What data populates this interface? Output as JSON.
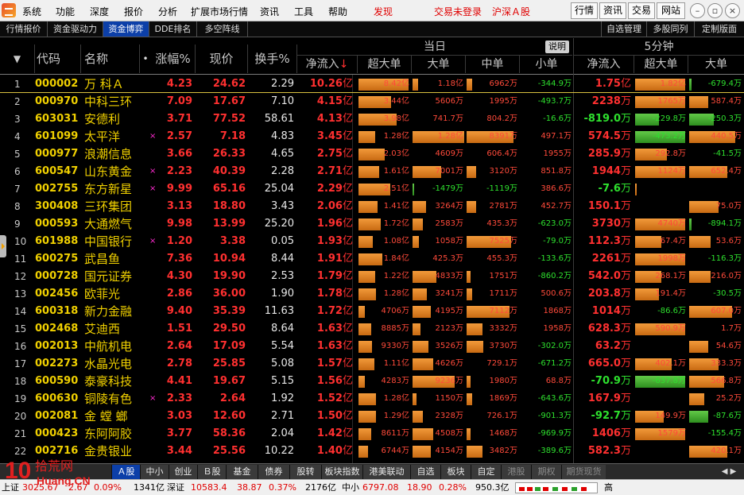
{
  "menubar": {
    "items": [
      "系统",
      "功能",
      "深度",
      "报价",
      "分析",
      "扩展市场行情",
      "资讯",
      "工具",
      "帮助"
    ],
    "discover": "发现",
    "trade_status": "交易未登录",
    "market_label": "沪深Ａ股",
    "buttons": [
      "行情",
      "资讯",
      "交易",
      "网站"
    ],
    "window_controls": [
      "minimize-icon",
      "restore-icon",
      "close-icon"
    ]
  },
  "tabs": {
    "left": [
      "行情报价",
      "资金驱动力",
      "资金博弈",
      "DDE排名",
      "多空阵线"
    ],
    "active": "资金博弈",
    "right": [
      "自选管理",
      "多股同列",
      "定制版面"
    ]
  },
  "header": {
    "sort_arrow": "▼",
    "code": "代码",
    "name": "名称",
    "name_dot": "•",
    "pct": "涨幅%",
    "price": "现价",
    "turnover": "换手%",
    "group_today": "当日",
    "explain": "说明",
    "group_5min": "5分钟",
    "net_inflow": "净流入",
    "net_sort_arrow": "↓",
    "super_large": "超大单",
    "large": "大单",
    "medium": "中单",
    "small": "小单",
    "net_inflow_5": "净流入",
    "super_large_5": "超大单",
    "large_5": "大单"
  },
  "bar_levels": "each bar fill is a fraction 0–1 of the cell width",
  "rows": [
    {
      "i": "1",
      "code": "000002",
      "name": "万 科Ａ",
      "mark": "",
      "pct": "4.23",
      "px": "24.62",
      "to": "2.29",
      "net": "10.26",
      "nu": "亿",
      "sl": {
        "t": "8.42亿",
        "f": 0.95
      },
      "lg": {
        "t": "1.18亿",
        "f": 0.1
      },
      "md": {
        "t": "6962万",
        "f": 0.1
      },
      "sm": {
        "t": "-344.9万",
        "f": 0.0,
        "neg": true
      },
      "net5": "1.75",
      "nu5": "亿",
      "sl5": {
        "t": "1.82亿",
        "f": 0.95
      },
      "lg5": {
        "t": "-679.4万",
        "f": 0.05,
        "neg": true
      }
    },
    {
      "i": "2",
      "code": "000970",
      "name": "中科三环",
      "mark": "",
      "pct": "7.09",
      "px": "17.67",
      "to": "7.10",
      "net": "4.15",
      "nu": "亿",
      "sl": {
        "t": "3.44亿",
        "f": 0.62
      },
      "lg": {
        "t": "5606万",
        "f": 0.0
      },
      "md": {
        "t": "1995万",
        "f": 0.0
      },
      "sm": {
        "t": "-493.7万",
        "f": 0.0,
        "neg": true
      },
      "net5": "2238",
      "nu5": "万",
      "sl5": {
        "t": "1765万",
        "f": 0.95
      },
      "lg5": {
        "t": "587.4万",
        "f": 0.35
      }
    },
    {
      "i": "3",
      "code": "603031",
      "name": "安德利",
      "mark": "",
      "pct": "3.71",
      "px": "77.52",
      "to": "58.61",
      "net": "4.13",
      "nu": "亿",
      "sl": {
        "t": "3.98亿",
        "f": 0.72
      },
      "lg": {
        "t": "741.7万",
        "f": 0.0
      },
      "md": {
        "t": "804.2万",
        "f": 0.0
      },
      "sm": {
        "t": "-16.6万",
        "f": 0.0,
        "neg": true
      },
      "net5": "-819.0",
      "nu5": "万",
      "neg5": true,
      "sl5": {
        "t": "-229.8万",
        "f": 0.45,
        "neg": true
      },
      "lg5": {
        "t": "-250.3万",
        "f": 0.45,
        "neg": true
      }
    },
    {
      "i": "4",
      "code": "601099",
      "name": "太平洋",
      "mark": "×",
      "pct": "2.57",
      "px": "7.18",
      "to": "4.83",
      "net": "3.45",
      "nu": "亿",
      "sl": {
        "t": "1.28亿",
        "f": 0.32
      },
      "lg": {
        "t": "1.28亿",
        "f": 0.98
      },
      "md": {
        "t": "8391万",
        "f": 0.9
      },
      "sm": {
        "t": "497.1万",
        "f": 0.0
      },
      "net5": "574.5",
      "nu5": "万",
      "sl5": {
        "t": "-473.2万",
        "f": 0.95,
        "neg": true
      },
      "lg5": {
        "t": "440.5万",
        "f": 0.85
      }
    },
    {
      "i": "5",
      "code": "000977",
      "name": "浪潮信息",
      "mark": "",
      "pct": "3.66",
      "px": "26.33",
      "to": "4.65",
      "net": "2.75",
      "nu": "亿",
      "sl": {
        "t": "2.03亿",
        "f": 0.5
      },
      "lg": {
        "t": "4609万",
        "f": 0.0
      },
      "md": {
        "t": "606.4万",
        "f": 0.0
      },
      "sm": {
        "t": "1955万",
        "f": 0.0
      },
      "net5": "285.9",
      "nu5": "万",
      "sl5": {
        "t": "292.8万",
        "f": 0.6
      },
      "lg5": {
        "t": "-41.5万",
        "f": 0.0,
        "neg": true
      }
    },
    {
      "i": "6",
      "code": "600547",
      "name": "山东黄金",
      "mark": "×",
      "pct": "2.23",
      "px": "40.39",
      "to": "2.28",
      "net": "2.71",
      "nu": "亿",
      "sl": {
        "t": "1.61亿",
        "f": 0.4
      },
      "lg": {
        "t": "7001万",
        "f": 0.55
      },
      "md": {
        "t": "3120万",
        "f": 0.18
      },
      "sm": {
        "t": "851.8万",
        "f": 0.0
      },
      "net5": "1944",
      "nu5": "万",
      "sl5": {
        "t": "1124万",
        "f": 0.95
      },
      "lg5": {
        "t": "652.4万",
        "f": 0.7
      }
    },
    {
      "i": "7",
      "code": "002755",
      "name": "东方新星",
      "mark": "×",
      "pct": "9.99",
      "px": "65.16",
      "to": "25.04",
      "net": "2.29",
      "nu": "亿",
      "sl": {
        "t": "2.51亿",
        "f": 0.6
      },
      "lg": {
        "t": "-1479万",
        "f": 0.03,
        "neg": true
      },
      "md": {
        "t": "-1119万",
        "f": 0.0,
        "neg": true
      },
      "sm": {
        "t": "386.6万",
        "f": 0.0
      },
      "net5": "-7.6",
      "nu5": "万",
      "neg5": true,
      "sl5": {
        "t": "",
        "f": 0.02
      },
      "lg5": {
        "t": "",
        "f": 0.0
      }
    },
    {
      "i": "8",
      "code": "300408",
      "name": "三环集团",
      "mark": "",
      "pct": "3.13",
      "px": "18.80",
      "to": "3.43",
      "net": "2.06",
      "nu": "亿",
      "sl": {
        "t": "1.41亿",
        "f": 0.36
      },
      "lg": {
        "t": "3264万",
        "f": 0.25
      },
      "md": {
        "t": "2781万",
        "f": 0.18
      },
      "sm": {
        "t": "452.7万",
        "f": 0.0
      },
      "net5": "150.1",
      "nu5": "万",
      "sl5": {
        "t": "",
        "f": 0.0
      },
      "lg5": {
        "t": "75.0万",
        "f": 0.55
      }
    },
    {
      "i": "9",
      "code": "000593",
      "name": "大通燃气",
      "mark": "",
      "pct": "9.98",
      "px": "13.99",
      "to": "25.20",
      "net": "1.96",
      "nu": "亿",
      "sl": {
        "t": "1.72亿",
        "f": 0.42
      },
      "lg": {
        "t": "2583万",
        "f": 0.2
      },
      "md": {
        "t": "435.3万",
        "f": 0.0
      },
      "sm": {
        "t": "-623.0万",
        "f": 0.0,
        "neg": true
      },
      "net5": "3730",
      "nu5": "万",
      "sl5": {
        "t": "4740万",
        "f": 0.95
      },
      "lg5": {
        "t": "-894.1万",
        "f": 0.05,
        "neg": true
      }
    },
    {
      "i": "10",
      "code": "601988",
      "name": "中国银行",
      "mark": "×",
      "pct": "1.20",
      "px": "3.38",
      "to": "0.05",
      "net": "1.93",
      "nu": "亿",
      "sl": {
        "t": "1.08亿",
        "f": 0.28
      },
      "lg": {
        "t": "1058万",
        "f": 0.12
      },
      "md": {
        "t": "7525万",
        "f": 0.85
      },
      "sm": {
        "t": "-79.0万",
        "f": 0.0,
        "neg": true
      },
      "net5": "112.3",
      "nu5": "万",
      "sl5": {
        "t": "67.4万",
        "f": 0.5
      },
      "lg5": {
        "t": "53.6万",
        "f": 0.4
      }
    },
    {
      "i": "11",
      "code": "600275",
      "name": "武昌鱼",
      "mark": "",
      "pct": "7.36",
      "px": "10.94",
      "to": "8.44",
      "net": "1.91",
      "nu": "亿",
      "sl": {
        "t": "1.84亿",
        "f": 0.45
      },
      "lg": {
        "t": "425.3万",
        "f": 0.0
      },
      "md": {
        "t": "455.3万",
        "f": 0.0
      },
      "sm": {
        "t": "-133.6万",
        "f": 0.0,
        "neg": true
      },
      "net5": "2261",
      "nu5": "万",
      "sl5": {
        "t": "1998万",
        "f": 0.95
      },
      "lg5": {
        "t": "-116.3万",
        "f": 0.0,
        "neg": true
      }
    },
    {
      "i": "12",
      "code": "000728",
      "name": "国元证券",
      "mark": "",
      "pct": "4.30",
      "px": "19.90",
      "to": "2.53",
      "net": "1.79",
      "nu": "亿",
      "sl": {
        "t": "1.22亿",
        "f": 0.32
      },
      "lg": {
        "t": "4833万",
        "f": 0.45
      },
      "md": {
        "t": "1751万",
        "f": 0.08
      },
      "sm": {
        "t": "-860.2万",
        "f": 0.0,
        "neg": true
      },
      "net5": "542.0",
      "nu5": "万",
      "sl5": {
        "t": "268.1万",
        "f": 0.5
      },
      "lg5": {
        "t": "216.0万",
        "f": 0.4
      }
    },
    {
      "i": "13",
      "code": "002456",
      "name": "欧菲光",
      "mark": "",
      "pct": "2.86",
      "px": "36.00",
      "to": "1.90",
      "net": "1.78",
      "nu": "亿",
      "sl": {
        "t": "1.28亿",
        "f": 0.34
      },
      "lg": {
        "t": "3241万",
        "f": 0.28
      },
      "md": {
        "t": "1711万",
        "f": 0.1
      },
      "sm": {
        "t": "500.6万",
        "f": 0.0
      },
      "net5": "203.8",
      "nu5": "万",
      "sl5": {
        "t": "191.4万",
        "f": 0.45
      },
      "lg5": {
        "t": "-30.5万",
        "f": 0.0,
        "neg": true
      }
    },
    {
      "i": "14",
      "code": "600318",
      "name": "新力金融",
      "mark": "",
      "pct": "9.40",
      "px": "35.39",
      "to": "11.63",
      "net": "1.72",
      "nu": "亿",
      "sl": {
        "t": "4706万",
        "f": 0.12
      },
      "lg": {
        "t": "4195万",
        "f": 0.35
      },
      "md": {
        "t": "7112万",
        "f": 0.82
      },
      "sm": {
        "t": "1868万",
        "f": 0.0
      },
      "net5": "1014",
      "nu5": "万",
      "sl5": {
        "t": "-86.6万",
        "f": 0.0,
        "neg": true
      },
      "lg5": {
        "t": "607.0万",
        "f": 0.8
      }
    },
    {
      "i": "15",
      "code": "002468",
      "name": "艾迪西",
      "mark": "",
      "pct": "1.51",
      "px": "29.50",
      "to": "8.64",
      "net": "1.63",
      "nu": "亿",
      "sl": {
        "t": "8885万",
        "f": 0.24
      },
      "lg": {
        "t": "2123万",
        "f": 0.15
      },
      "md": {
        "t": "3332万",
        "f": 0.3
      },
      "sm": {
        "t": "1958万",
        "f": 0.0
      },
      "net5": "628.3",
      "nu5": "万",
      "sl5": {
        "t": "590.9万",
        "f": 0.95
      },
      "lg5": {
        "t": "1.7万",
        "f": 0.0
      }
    },
    {
      "i": "16",
      "code": "002013",
      "name": "中航机电",
      "mark": "",
      "pct": "2.64",
      "px": "17.09",
      "to": "5.54",
      "net": "1.63",
      "nu": "亿",
      "sl": {
        "t": "9330万",
        "f": 0.26
      },
      "lg": {
        "t": "3526万",
        "f": 0.3
      },
      "md": {
        "t": "3730万",
        "f": 0.32
      },
      "sm": {
        "t": "-302.0万",
        "f": 0.0,
        "neg": true
      },
      "net5": "63.2",
      "nu5": "万",
      "sl5": {
        "t": "",
        "f": 0.0
      },
      "lg5": {
        "t": "54.6万",
        "f": 0.35
      }
    },
    {
      "i": "17",
      "code": "002273",
      "name": "水晶光电",
      "mark": "",
      "pct": "2.78",
      "px": "25.85",
      "to": "5.08",
      "net": "1.57",
      "nu": "亿",
      "sl": {
        "t": "1.11亿",
        "f": 0.3
      },
      "lg": {
        "t": "4626万",
        "f": 0.4
      },
      "md": {
        "t": "729.1万",
        "f": 0.0
      },
      "sm": {
        "t": "-671.2万",
        "f": 0.0,
        "neg": true
      },
      "net5": "665.0",
      "nu5": "万",
      "sl5": {
        "t": "402.1万",
        "f": 0.7
      },
      "lg5": {
        "t": "333.3万",
        "f": 0.55
      }
    },
    {
      "i": "18",
      "code": "600590",
      "name": "泰豪科技",
      "mark": "",
      "pct": "4.41",
      "px": "19.67",
      "to": "5.15",
      "net": "1.56",
      "nu": "亿",
      "sl": {
        "t": "4283万",
        "f": 0.12
      },
      "lg": {
        "t": "9236万",
        "f": 0.8
      },
      "md": {
        "t": "1980万",
        "f": 0.08
      },
      "sm": {
        "t": "68.8万",
        "f": 0.0
      },
      "net5": "-70.9",
      "nu5": "万",
      "neg5": true,
      "sl5": {
        "t": "-637.8万",
        "f": 0.95,
        "neg": true
      },
      "lg5": {
        "t": "566.8万",
        "f": 0.65
      }
    },
    {
      "i": "19",
      "code": "600630",
      "name": "铜陵有色",
      "mark": "×",
      "pct": "2.33",
      "px": "2.64",
      "to": "1.92",
      "net": "1.52",
      "nu": "亿",
      "sl": {
        "t": "1.28亿",
        "f": 0.34
      },
      "lg": {
        "t": "1150万",
        "f": 0.08
      },
      "md": {
        "t": "1869万",
        "f": 0.1
      },
      "sm": {
        "t": "-643.6万",
        "f": 0.0,
        "neg": true
      },
      "net5": "167.9",
      "nu5": "万",
      "sl5": {
        "t": "",
        "f": 0.0
      },
      "lg5": {
        "t": "25.2万",
        "f": 0.28
      }
    },
    {
      "i": "20",
      "code": "002081",
      "name": "金 螳 螂",
      "mark": "",
      "pct": "3.03",
      "px": "12.60",
      "to": "2.71",
      "net": "1.50",
      "nu": "亿",
      "sl": {
        "t": "1.29亿",
        "f": 0.34
      },
      "lg": {
        "t": "2328万",
        "f": 0.2
      },
      "md": {
        "t": "726.1万",
        "f": 0.0
      },
      "sm": {
        "t": "-901.3万",
        "f": 0.0,
        "neg": true
      },
      "net5": "-92.7",
      "nu5": "万",
      "neg5": true,
      "sl5": {
        "t": "149.9万",
        "f": 0.55
      },
      "lg5": {
        "t": "-87.6万",
        "f": 0.35,
        "neg": true
      }
    },
    {
      "i": "21",
      "code": "000423",
      "name": "东阿阿胶",
      "mark": "",
      "pct": "3.77",
      "px": "58.36",
      "to": "2.04",
      "net": "1.42",
      "nu": "亿",
      "sl": {
        "t": "8611万",
        "f": 0.24
      },
      "lg": {
        "t": "4508万",
        "f": 0.4
      },
      "md": {
        "t": "1468万",
        "f": 0.08
      },
      "sm": {
        "t": "-969.9万",
        "f": 0.0,
        "neg": true
      },
      "net5": "1406",
      "nu5": "万",
      "sl5": {
        "t": "1579万",
        "f": 0.95
      },
      "lg5": {
        "t": "-155.4万",
        "f": 0.0,
        "neg": true
      }
    },
    {
      "i": "22",
      "code": "002716",
      "name": "金贵银业",
      "mark": "",
      "pct": "3.44",
      "px": "25.56",
      "to": "10.22",
      "net": "1.40",
      "nu": "亿",
      "sl": {
        "t": "6744万",
        "f": 0.18
      },
      "lg": {
        "t": "4154万",
        "f": 0.35
      },
      "md": {
        "t": "3482万",
        "f": 0.3
      },
      "sm": {
        "t": "-389.6万",
        "f": 0.0,
        "neg": true
      },
      "net5": "582.3",
      "nu5": "万",
      "sl5": {
        "t": "",
        "f": 0.0
      },
      "lg5": {
        "t": "420.1万",
        "f": 0.7
      }
    }
  ],
  "bottom_tabs": [
    "Ａ股",
    "中小",
    "创业",
    "Ｂ股",
    "基金",
    "债券",
    "股转",
    "板块指数",
    "港美联动",
    "自选",
    "板块",
    "自定",
    "港股",
    "期权",
    "期货现货"
  ],
  "bottom_active": "Ａ股",
  "status": {
    "sh_label": "上证",
    "sh_val": "3025.67",
    "sh_chg": "2.67",
    "sh_pct": "0.09%",
    "sh_amt": "1341亿",
    "sz_label": "深证",
    "sz_val": "10583.4",
    "sz_chg": "38.87",
    "sz_pct": "0.37%",
    "sz_amt": "2176亿",
    "zx_label": "中小",
    "zx_val": "6797.08",
    "zx_chg": "18.90",
    "zx_pct": "0.28%",
    "zx_amt": "950.3亿",
    "more": "高"
  },
  "watermark": {
    "number": "10",
    "cn": "拾荒网",
    "en": "Huang.CN"
  },
  "colors": {
    "up": "#ff3030",
    "down": "#2ee02e",
    "code": "#f0d000",
    "bar": "#f29a3a",
    "active_tab": "#0c3fa8"
  }
}
